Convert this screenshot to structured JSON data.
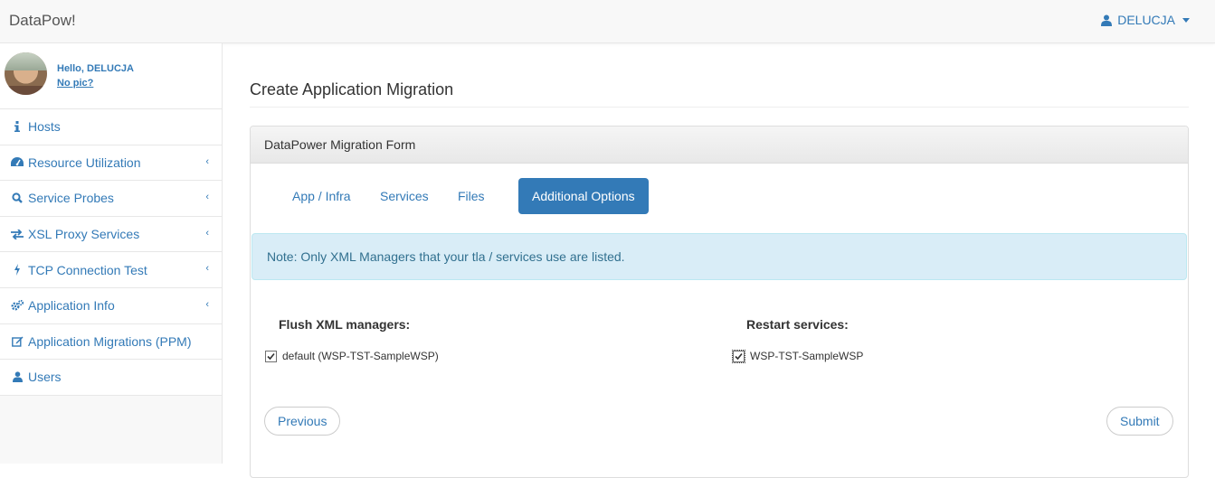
{
  "app": {
    "brand": "DataPow!"
  },
  "user": {
    "name": "DELUCJA"
  },
  "sidebar": {
    "greeting": "Hello, DELUCJA",
    "no_pic": "No pic?",
    "items": [
      {
        "label": "Hosts",
        "icon": "info-icon",
        "chevron": false
      },
      {
        "label": "Resource Utilization",
        "icon": "dashboard-icon",
        "chevron": true
      },
      {
        "label": "Service Probes",
        "icon": "search-icon",
        "chevron": true
      },
      {
        "label": "XSL Proxy Services",
        "icon": "exchange-icon",
        "chevron": true
      },
      {
        "label": "TCP Connection Test",
        "icon": "bolt-icon",
        "chevron": true
      },
      {
        "label": "Application Info",
        "icon": "cogs-icon",
        "chevron": true
      },
      {
        "label": "Application Migrations (PPM)",
        "icon": "edit-icon",
        "chevron": false
      },
      {
        "label": "Users",
        "icon": "user-icon",
        "chevron": false
      }
    ]
  },
  "page": {
    "title": "Create Application Migration"
  },
  "panel": {
    "heading": "DataPower Migration Form",
    "tabs": [
      {
        "label": "App / Infra",
        "active": false
      },
      {
        "label": "Services",
        "active": false
      },
      {
        "label": "Files",
        "active": false
      },
      {
        "label": "Additional Options",
        "active": true
      }
    ],
    "note": "Note: Only XML Managers that your tla / services use are listed.",
    "flush": {
      "heading": "Flush XML managers:",
      "item": "default (WSP-TST-SampleWSP)",
      "checked": true
    },
    "restart": {
      "heading": "Restart services:",
      "item": "WSP-TST-SampleWSP",
      "checked": true
    },
    "previous_label": "Previous",
    "submit_label": "Submit"
  },
  "colors": {
    "link": "#337ab7",
    "info_bg": "#d9edf7",
    "info_text": "#31708f"
  }
}
